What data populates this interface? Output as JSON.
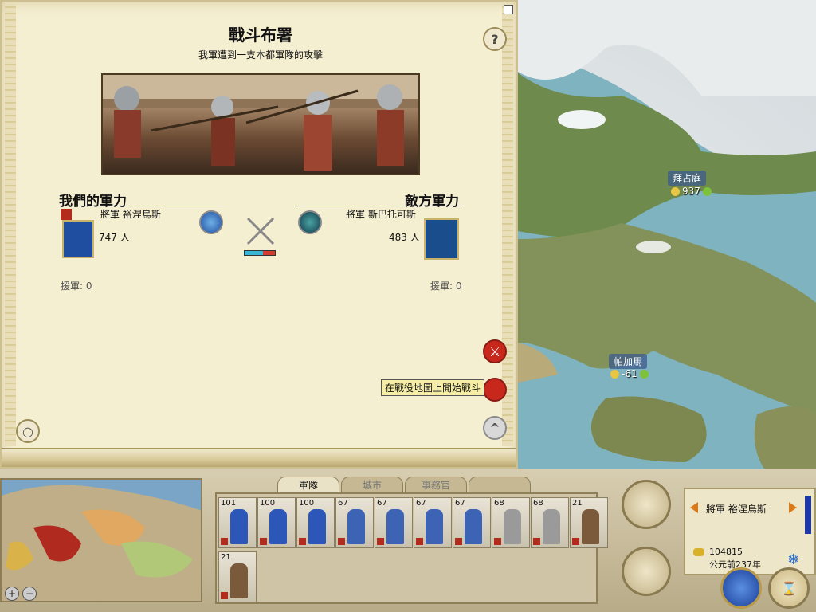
{
  "scroll": {
    "title": "戰斗布署",
    "subtitle": "我軍遭到一支本都軍隊的攻擊",
    "help": "?",
    "our": {
      "heading": "我們的軍力",
      "general": "將軍 裕涅烏斯",
      "men": "747 人",
      "reinforcements": "援軍: 0",
      "banner_color": "#1f4ea0"
    },
    "enemy": {
      "heading": "敵方軍力",
      "general": "將軍 斯巴托可斯",
      "men": "483 人",
      "reinforcements": "援軍: 0",
      "banner_color": "#1a4d8c"
    },
    "balance": {
      "our_share": 0.6,
      "our_color": "#3bb5d6",
      "enemy_color": "#d23b2f"
    },
    "tooltip": "在戰役地圖上開始戰斗"
  },
  "map": {
    "cities": [
      {
        "name": "拜占庭",
        "stat": "937"
      },
      {
        "name": "帕加馬",
        "stat": "-61"
      }
    ]
  },
  "bottom": {
    "tabs": [
      {
        "label": "軍隊",
        "active": true
      },
      {
        "label": "城市",
        "active": false
      },
      {
        "label": "事務官",
        "active": false
      },
      {
        "label": "",
        "active": false
      }
    ],
    "units": [
      {
        "count": "101",
        "kind": "infantry"
      },
      {
        "count": "100",
        "kind": "infantry"
      },
      {
        "count": "100",
        "kind": "infantry"
      },
      {
        "count": "67",
        "kind": "archer"
      },
      {
        "count": "67",
        "kind": "archer"
      },
      {
        "count": "67",
        "kind": "archer"
      },
      {
        "count": "67",
        "kind": "archer"
      },
      {
        "count": "68",
        "kind": "hoplite"
      },
      {
        "count": "68",
        "kind": "hoplite"
      },
      {
        "count": "21",
        "kind": "siege"
      },
      {
        "count": "21",
        "kind": "siege"
      }
    ],
    "general_name": "將軍 裕涅烏斯",
    "money": "104815",
    "year": "公元前237年"
  }
}
